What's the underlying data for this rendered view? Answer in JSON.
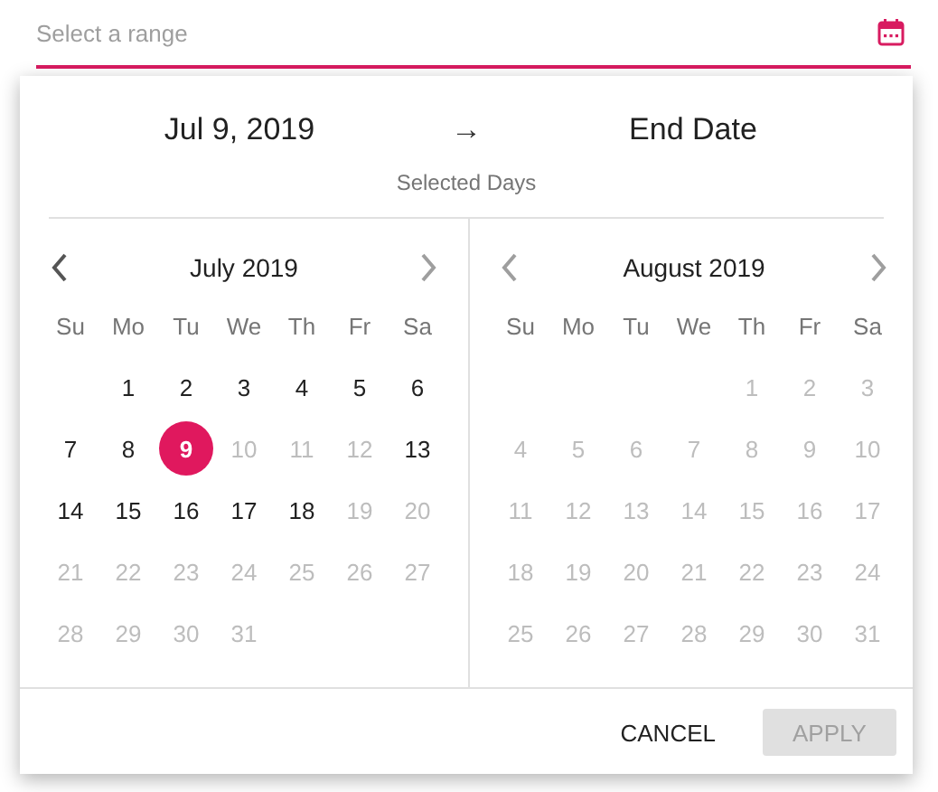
{
  "field": {
    "placeholder": "Select a range"
  },
  "summary": {
    "start": "Jul 9, 2019",
    "arrow": "→",
    "end": "End Date",
    "caption": "Selected Days"
  },
  "months": [
    {
      "title": "July 2019",
      "prev_disabled": false,
      "next_disabled": true,
      "weekdays": [
        "Su",
        "Mo",
        "Tu",
        "We",
        "Th",
        "Fr",
        "Sa"
      ],
      "days": [
        {
          "kind": "blank"
        },
        {
          "kind": "day",
          "text": "1",
          "disabled": false,
          "selected": false
        },
        {
          "kind": "day",
          "text": "2",
          "disabled": false,
          "selected": false
        },
        {
          "kind": "day",
          "text": "3",
          "disabled": false,
          "selected": false
        },
        {
          "kind": "day",
          "text": "4",
          "disabled": false,
          "selected": false
        },
        {
          "kind": "day",
          "text": "5",
          "disabled": false,
          "selected": false
        },
        {
          "kind": "day",
          "text": "6",
          "disabled": false,
          "selected": false
        },
        {
          "kind": "day",
          "text": "7",
          "disabled": false,
          "selected": false
        },
        {
          "kind": "day",
          "text": "8",
          "disabled": false,
          "selected": false
        },
        {
          "kind": "day",
          "text": "9",
          "disabled": false,
          "selected": true
        },
        {
          "kind": "day",
          "text": "10",
          "disabled": true,
          "selected": false
        },
        {
          "kind": "day",
          "text": "11",
          "disabled": true,
          "selected": false
        },
        {
          "kind": "day",
          "text": "12",
          "disabled": true,
          "selected": false
        },
        {
          "kind": "day",
          "text": "13",
          "disabled": false,
          "selected": false
        },
        {
          "kind": "day",
          "text": "14",
          "disabled": false,
          "selected": false
        },
        {
          "kind": "day",
          "text": "15",
          "disabled": false,
          "selected": false
        },
        {
          "kind": "day",
          "text": "16",
          "disabled": false,
          "selected": false
        },
        {
          "kind": "day",
          "text": "17",
          "disabled": false,
          "selected": false
        },
        {
          "kind": "day",
          "text": "18",
          "disabled": false,
          "selected": false
        },
        {
          "kind": "day",
          "text": "19",
          "disabled": true,
          "selected": false
        },
        {
          "kind": "day",
          "text": "20",
          "disabled": true,
          "selected": false
        },
        {
          "kind": "day",
          "text": "21",
          "disabled": true,
          "selected": false
        },
        {
          "kind": "day",
          "text": "22",
          "disabled": true,
          "selected": false
        },
        {
          "kind": "day",
          "text": "23",
          "disabled": true,
          "selected": false
        },
        {
          "kind": "day",
          "text": "24",
          "disabled": true,
          "selected": false
        },
        {
          "kind": "day",
          "text": "25",
          "disabled": true,
          "selected": false
        },
        {
          "kind": "day",
          "text": "26",
          "disabled": true,
          "selected": false
        },
        {
          "kind": "day",
          "text": "27",
          "disabled": true,
          "selected": false
        },
        {
          "kind": "day",
          "text": "28",
          "disabled": true,
          "selected": false
        },
        {
          "kind": "day",
          "text": "29",
          "disabled": true,
          "selected": false
        },
        {
          "kind": "day",
          "text": "30",
          "disabled": true,
          "selected": false
        },
        {
          "kind": "day",
          "text": "31",
          "disabled": true,
          "selected": false
        }
      ]
    },
    {
      "title": "August 2019",
      "prev_disabled": true,
      "next_disabled": true,
      "weekdays": [
        "Su",
        "Mo",
        "Tu",
        "We",
        "Th",
        "Fr",
        "Sa"
      ],
      "days": [
        {
          "kind": "blank"
        },
        {
          "kind": "blank"
        },
        {
          "kind": "blank"
        },
        {
          "kind": "blank"
        },
        {
          "kind": "day",
          "text": "1",
          "disabled": true,
          "selected": false
        },
        {
          "kind": "day",
          "text": "2",
          "disabled": true,
          "selected": false
        },
        {
          "kind": "day",
          "text": "3",
          "disabled": true,
          "selected": false
        },
        {
          "kind": "day",
          "text": "4",
          "disabled": true,
          "selected": false
        },
        {
          "kind": "day",
          "text": "5",
          "disabled": true,
          "selected": false
        },
        {
          "kind": "day",
          "text": "6",
          "disabled": true,
          "selected": false
        },
        {
          "kind": "day",
          "text": "7",
          "disabled": true,
          "selected": false
        },
        {
          "kind": "day",
          "text": "8",
          "disabled": true,
          "selected": false
        },
        {
          "kind": "day",
          "text": "9",
          "disabled": true,
          "selected": false
        },
        {
          "kind": "day",
          "text": "10",
          "disabled": true,
          "selected": false
        },
        {
          "kind": "day",
          "text": "11",
          "disabled": true,
          "selected": false
        },
        {
          "kind": "day",
          "text": "12",
          "disabled": true,
          "selected": false
        },
        {
          "kind": "day",
          "text": "13",
          "disabled": true,
          "selected": false
        },
        {
          "kind": "day",
          "text": "14",
          "disabled": true,
          "selected": false
        },
        {
          "kind": "day",
          "text": "15",
          "disabled": true,
          "selected": false
        },
        {
          "kind": "day",
          "text": "16",
          "disabled": true,
          "selected": false
        },
        {
          "kind": "day",
          "text": "17",
          "disabled": true,
          "selected": false
        },
        {
          "kind": "day",
          "text": "18",
          "disabled": true,
          "selected": false
        },
        {
          "kind": "day",
          "text": "19",
          "disabled": true,
          "selected": false
        },
        {
          "kind": "day",
          "text": "20",
          "disabled": true,
          "selected": false
        },
        {
          "kind": "day",
          "text": "21",
          "disabled": true,
          "selected": false
        },
        {
          "kind": "day",
          "text": "22",
          "disabled": true,
          "selected": false
        },
        {
          "kind": "day",
          "text": "23",
          "disabled": true,
          "selected": false
        },
        {
          "kind": "day",
          "text": "24",
          "disabled": true,
          "selected": false
        },
        {
          "kind": "day",
          "text": "25",
          "disabled": true,
          "selected": false
        },
        {
          "kind": "day",
          "text": "26",
          "disabled": true,
          "selected": false
        },
        {
          "kind": "day",
          "text": "27",
          "disabled": true,
          "selected": false
        },
        {
          "kind": "day",
          "text": "28",
          "disabled": true,
          "selected": false
        },
        {
          "kind": "day",
          "text": "29",
          "disabled": true,
          "selected": false
        },
        {
          "kind": "day",
          "text": "30",
          "disabled": true,
          "selected": false
        },
        {
          "kind": "day",
          "text": "31",
          "disabled": true,
          "selected": false
        }
      ]
    }
  ],
  "buttons": [
    {
      "label": "CANCEL",
      "disabled": false
    },
    {
      "label": "APPLY",
      "disabled": true
    }
  ]
}
